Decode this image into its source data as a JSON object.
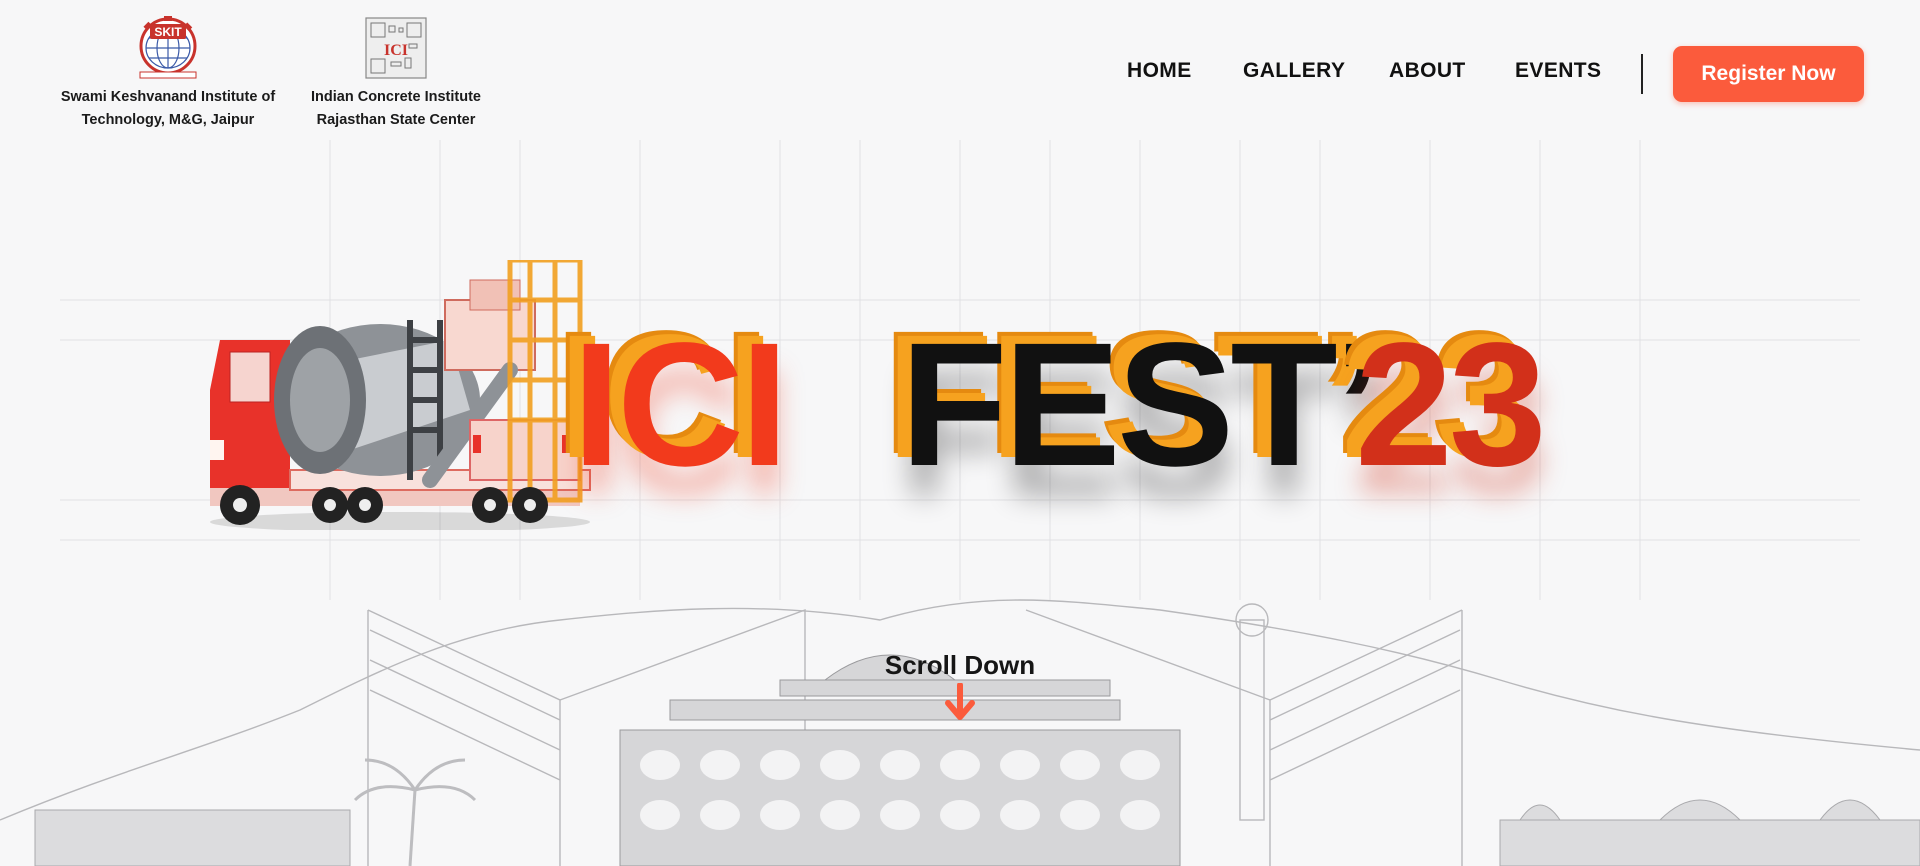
{
  "logos": {
    "skit": {
      "mark_text": "SKIT",
      "caption_line1": "Swami Keshvanand Institute of",
      "caption_line2": "Technology, M&G, Jaipur"
    },
    "ici": {
      "mark_text": "ICI",
      "caption_line1": "Indian Concrete Institute",
      "caption_line2": "Rajasthan State Center"
    }
  },
  "nav": {
    "items": [
      {
        "label": "HOME"
      },
      {
        "label": "GALLERY"
      },
      {
        "label": "ABOUT"
      },
      {
        "label": "EVENTS"
      }
    ],
    "register_label": "Register Now"
  },
  "hero": {
    "title_part1": "ICI",
    "title_part2": "FEST’",
    "title_part3": "23"
  },
  "scroll": {
    "label": "Scroll Down",
    "icon": "arrow-down-icon"
  },
  "colors": {
    "accent": "#fb5b3c",
    "title_red": "#f23a1c",
    "title_orange": "#f6a21f",
    "title_black": "#111111",
    "background": "#f7f7f8"
  }
}
